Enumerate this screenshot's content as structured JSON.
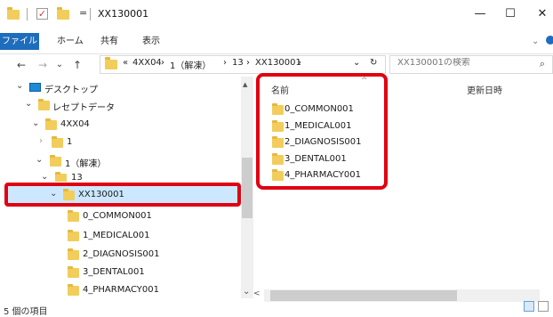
{
  "window": {
    "title": "XX130001",
    "qa_dropdown": "=",
    "minimize": "—",
    "maximize": "☐",
    "close": "✕"
  },
  "ribbon": {
    "file": "ファイル",
    "home": "ホーム",
    "share": "共有",
    "view": "表示",
    "collapse": "⌄"
  },
  "address": {
    "back": "←",
    "forward": "→",
    "recent": "⌄",
    "up": "↑",
    "overflow": "«",
    "crumbs": [
      "4XX04",
      "1（解凍）",
      "13",
      "XX130001"
    ],
    "sep": "›",
    "dropdown": "⌄",
    "refresh": "↻"
  },
  "search": {
    "placeholder": "XX130001の検索",
    "icon": "⌕"
  },
  "tree": {
    "desktop": "デスクトップ",
    "receipt_data": "レセプトデータ",
    "n4xx04": "4XX04",
    "one": "1",
    "one_unzip": "1（解凍）",
    "thirteen": "13",
    "xx130001": "XX130001",
    "children": [
      "0_COMMON001",
      "1_MEDICAL001",
      "2_DIAGNOSIS001",
      "3_DENTAL001",
      "4_PHARMACY001"
    ]
  },
  "content": {
    "col_name": "名前",
    "col_date": "更新日時",
    "sort": "^",
    "items": [
      "0_COMMON001",
      "1_MEDICAL001",
      "2_DIAGNOSIS001",
      "3_DENTAL001",
      "4_PHARMACY001"
    ]
  },
  "scroll": {
    "up": "▲",
    "down": "⌄",
    "left": "<"
  },
  "status": {
    "count": "5 個の項目"
  }
}
